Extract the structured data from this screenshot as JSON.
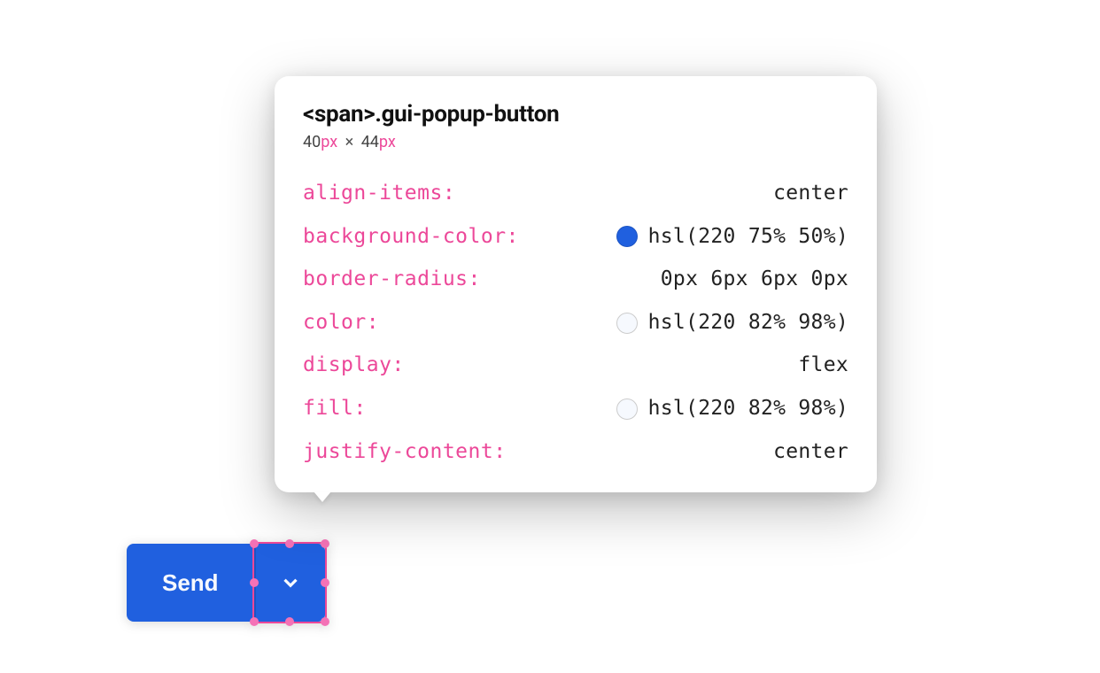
{
  "button": {
    "send_label": "Send"
  },
  "inspector": {
    "selector": "<span>.gui-popup-button",
    "dimensions": {
      "width_value": "40",
      "width_unit": "px",
      "separator": "×",
      "height_value": "44",
      "height_unit": "px"
    },
    "properties": [
      {
        "name": "align-items:",
        "value": "center",
        "swatch": null
      },
      {
        "name": "background-color:",
        "value": "hsl(220 75% 50%)",
        "swatch": "blue"
      },
      {
        "name": "border-radius:",
        "value": "0px 6px 6px 0px",
        "swatch": null
      },
      {
        "name": "color:",
        "value": "hsl(220 82% 98%)",
        "swatch": "light"
      },
      {
        "name": "display:",
        "value": "flex",
        "swatch": null
      },
      {
        "name": "fill:",
        "value": "hsl(220 82% 98%)",
        "swatch": "light"
      },
      {
        "name": "justify-content:",
        "value": "center",
        "swatch": null
      }
    ]
  }
}
